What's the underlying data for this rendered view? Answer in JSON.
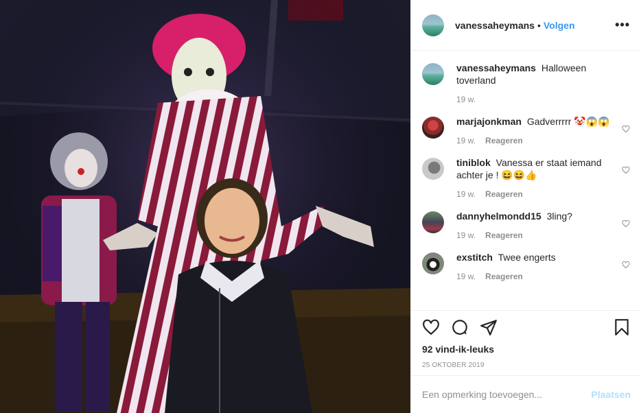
{
  "post": {
    "username": "vanessaheymans",
    "follow_label": "Volgen",
    "separator": "•",
    "more_label": "•••"
  },
  "comments": [
    {
      "username": "vanessaheymans",
      "text": "Halloween toverland",
      "time": "19 w.",
      "reply": ""
    },
    {
      "username": "marjajonkman",
      "text": "Gadverrrrr 🤡😱😱",
      "time": "19 w.",
      "reply": "Reageren"
    },
    {
      "username": "tiniblok",
      "text": "Vanessa er staat iemand achter je ! 😆😆👍",
      "time": "19 w.",
      "reply": "Reageren"
    },
    {
      "username": "dannyhelmondd15",
      "text": "3ling?",
      "time": "19 w.",
      "reply": "Reageren"
    },
    {
      "username": "exstitch",
      "text": "Twee engerts",
      "time": "19 w.",
      "reply": "Reageren"
    }
  ],
  "actions": {
    "likes": "92 vind-ik-leuks",
    "date": "25 OKTOBER 2019",
    "icons": [
      "heart-icon",
      "comment-icon",
      "share-icon",
      "bookmark-icon"
    ]
  },
  "add_comment": {
    "placeholder": "Een opmerking toevoegen...",
    "post_label": "Plaatsen"
  },
  "colors": {
    "link": "#3897f0",
    "post_disabled": "#b2dffc",
    "muted": "#8e8e8e"
  }
}
